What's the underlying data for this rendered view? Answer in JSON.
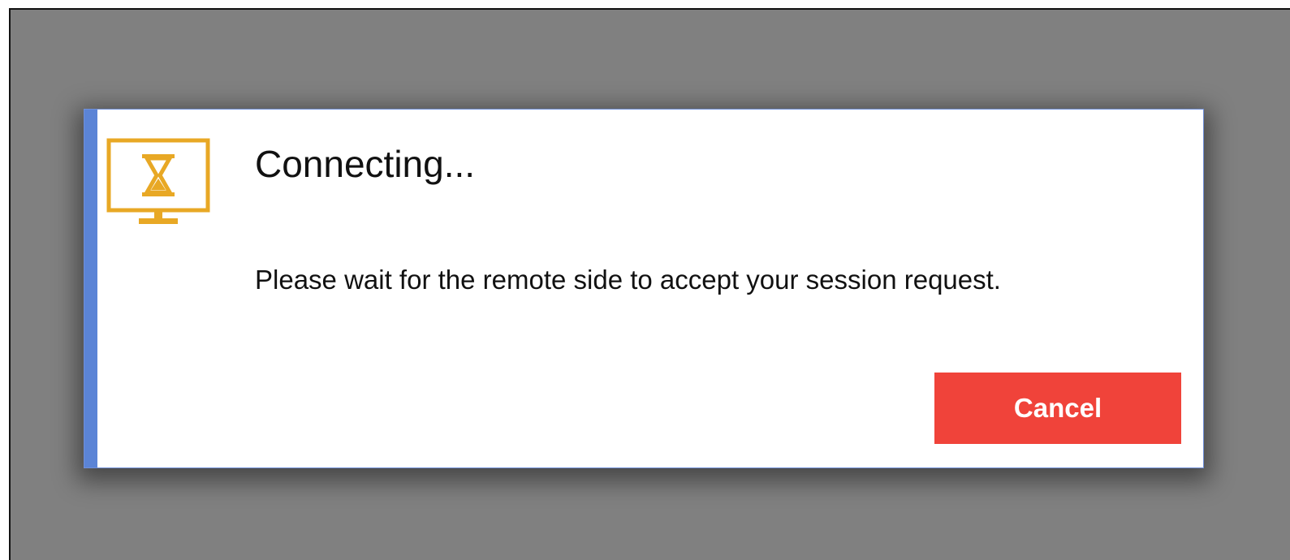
{
  "dialog": {
    "title": "Connecting...",
    "message": "Please wait for the remote side to accept your session request.",
    "cancel_label": "Cancel",
    "icon": "monitor-hourglass-icon"
  },
  "colors": {
    "backdrop": "#808080",
    "accent_bar": "#5b84d6",
    "icon": "#e8a825",
    "cancel_button": "#f0433a"
  }
}
